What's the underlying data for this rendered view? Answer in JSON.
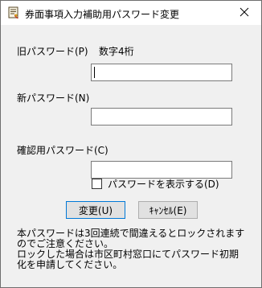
{
  "window": {
    "title": "券面事項入力補助用パスワード変更",
    "close_glyph": "✕"
  },
  "fields": {
    "old_password_label": "旧パスワード(P)",
    "old_password_hint": "数字4桁",
    "old_password_value": "",
    "new_password_label": "新パスワード(N)",
    "new_password_value": "",
    "confirm_password_label": "確認用パスワード(C)",
    "confirm_password_value": ""
  },
  "show_password": {
    "label": "パスワードを表示する(D)",
    "checked": false
  },
  "buttons": {
    "change": "変更(U)",
    "cancel": "ｷｬﾝｾﾙ(E)"
  },
  "notice": {
    "line1": "本パスワードは3回連続で間違えるとロックされます",
    "line2": "のでご注意ください。",
    "line3": "ロックした場合は市区町村窓口にてパスワード初期",
    "line4": "化を申請してください。"
  },
  "icons": {
    "app": "certificate-app-icon",
    "close": "close-icon"
  },
  "colors": {
    "window_bg": "#f0f0f0",
    "titlebar_bg": "#ffffff",
    "default_button_border": "#0078d7",
    "button_bg": "#e1e1e1"
  }
}
